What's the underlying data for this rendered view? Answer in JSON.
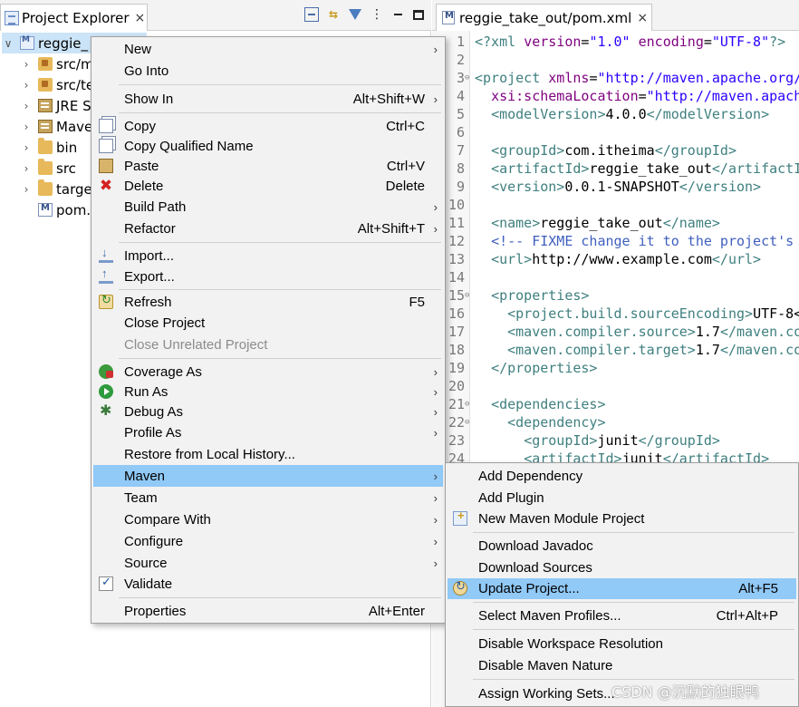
{
  "explorer": {
    "tab_label": "Project Explorer",
    "tab_close": "×",
    "tree": [
      {
        "label": "reggie_",
        "chevron": "∨"
      },
      {
        "label": "src/m",
        "chevron": "›"
      },
      {
        "label": "src/te",
        "chevron": "›"
      },
      {
        "label": "JRE S",
        "chevron": "›"
      },
      {
        "label": "Mave",
        "chevron": "›"
      },
      {
        "label": "bin",
        "chevron": "›"
      },
      {
        "label": "src",
        "chevron": "›"
      },
      {
        "label": "targe",
        "chevron": "›"
      },
      {
        "label": "pom.",
        "chevron": ""
      }
    ]
  },
  "editor": {
    "tab_label": "reggie_take_out/pom.xml",
    "tab_close": "×"
  },
  "context_menu": {
    "items": [
      {
        "label": "New",
        "shortcut": "",
        "submenu": true
      },
      {
        "label": "Go Into",
        "shortcut": "",
        "submenu": false
      },
      {
        "label": "Show In",
        "shortcut": "Alt+Shift+W",
        "submenu": true
      },
      {
        "label": "Copy",
        "shortcut": "Ctrl+C",
        "submenu": false
      },
      {
        "label": "Copy Qualified Name",
        "shortcut": "",
        "submenu": false
      },
      {
        "label": "Paste",
        "shortcut": "Ctrl+V",
        "submenu": false
      },
      {
        "label": "Delete",
        "shortcut": "Delete",
        "submenu": false
      },
      {
        "label": "Build Path",
        "shortcut": "",
        "submenu": true
      },
      {
        "label": "Refactor",
        "shortcut": "Alt+Shift+T",
        "submenu": true
      },
      {
        "label": "Import...",
        "shortcut": "",
        "submenu": false
      },
      {
        "label": "Export...",
        "shortcut": "",
        "submenu": false
      },
      {
        "label": "Refresh",
        "shortcut": "F5",
        "submenu": false
      },
      {
        "label": "Close Project",
        "shortcut": "",
        "submenu": false
      },
      {
        "label": "Close Unrelated Project",
        "shortcut": "",
        "submenu": false
      },
      {
        "label": "Coverage As",
        "shortcut": "",
        "submenu": true
      },
      {
        "label": "Run As",
        "shortcut": "",
        "submenu": true
      },
      {
        "label": "Debug As",
        "shortcut": "",
        "submenu": true
      },
      {
        "label": "Profile As",
        "shortcut": "",
        "submenu": true
      },
      {
        "label": "Restore from Local History...",
        "shortcut": "",
        "submenu": false
      },
      {
        "label": "Maven",
        "shortcut": "",
        "submenu": true
      },
      {
        "label": "Team",
        "shortcut": "",
        "submenu": true
      },
      {
        "label": "Compare With",
        "shortcut": "",
        "submenu": true
      },
      {
        "label": "Configure",
        "shortcut": "",
        "submenu": true
      },
      {
        "label": "Source",
        "shortcut": "",
        "submenu": true
      },
      {
        "label": "Validate",
        "shortcut": "",
        "submenu": false
      },
      {
        "label": "Properties",
        "shortcut": "Alt+Enter",
        "submenu": false
      }
    ]
  },
  "maven_submenu": {
    "items": [
      {
        "label": "Add Dependency",
        "shortcut": ""
      },
      {
        "label": "Add Plugin",
        "shortcut": ""
      },
      {
        "label": "New Maven Module Project",
        "shortcut": ""
      },
      {
        "label": "Download Javadoc",
        "shortcut": ""
      },
      {
        "label": "Download Sources",
        "shortcut": ""
      },
      {
        "label": "Update Project...",
        "shortcut": "Alt+F5"
      },
      {
        "label": "Select Maven Profiles...",
        "shortcut": "Ctrl+Alt+P"
      },
      {
        "label": "Disable Workspace Resolution",
        "shortcut": ""
      },
      {
        "label": "Disable Maven Nature",
        "shortcut": ""
      },
      {
        "label": "Assign Working Sets...",
        "shortcut": ""
      }
    ]
  },
  "submenu_arrow": "›",
  "watermark": "CSDN @沉默的独眼鸭",
  "colors": {
    "highlight": "#91c9f7",
    "menu_bg": "#f2f2f2",
    "xml_tag": "#3f7f7f",
    "xml_attr": "#7f007f",
    "xml_value": "#2a00ff",
    "xml_comment": "#3f5fbf"
  }
}
